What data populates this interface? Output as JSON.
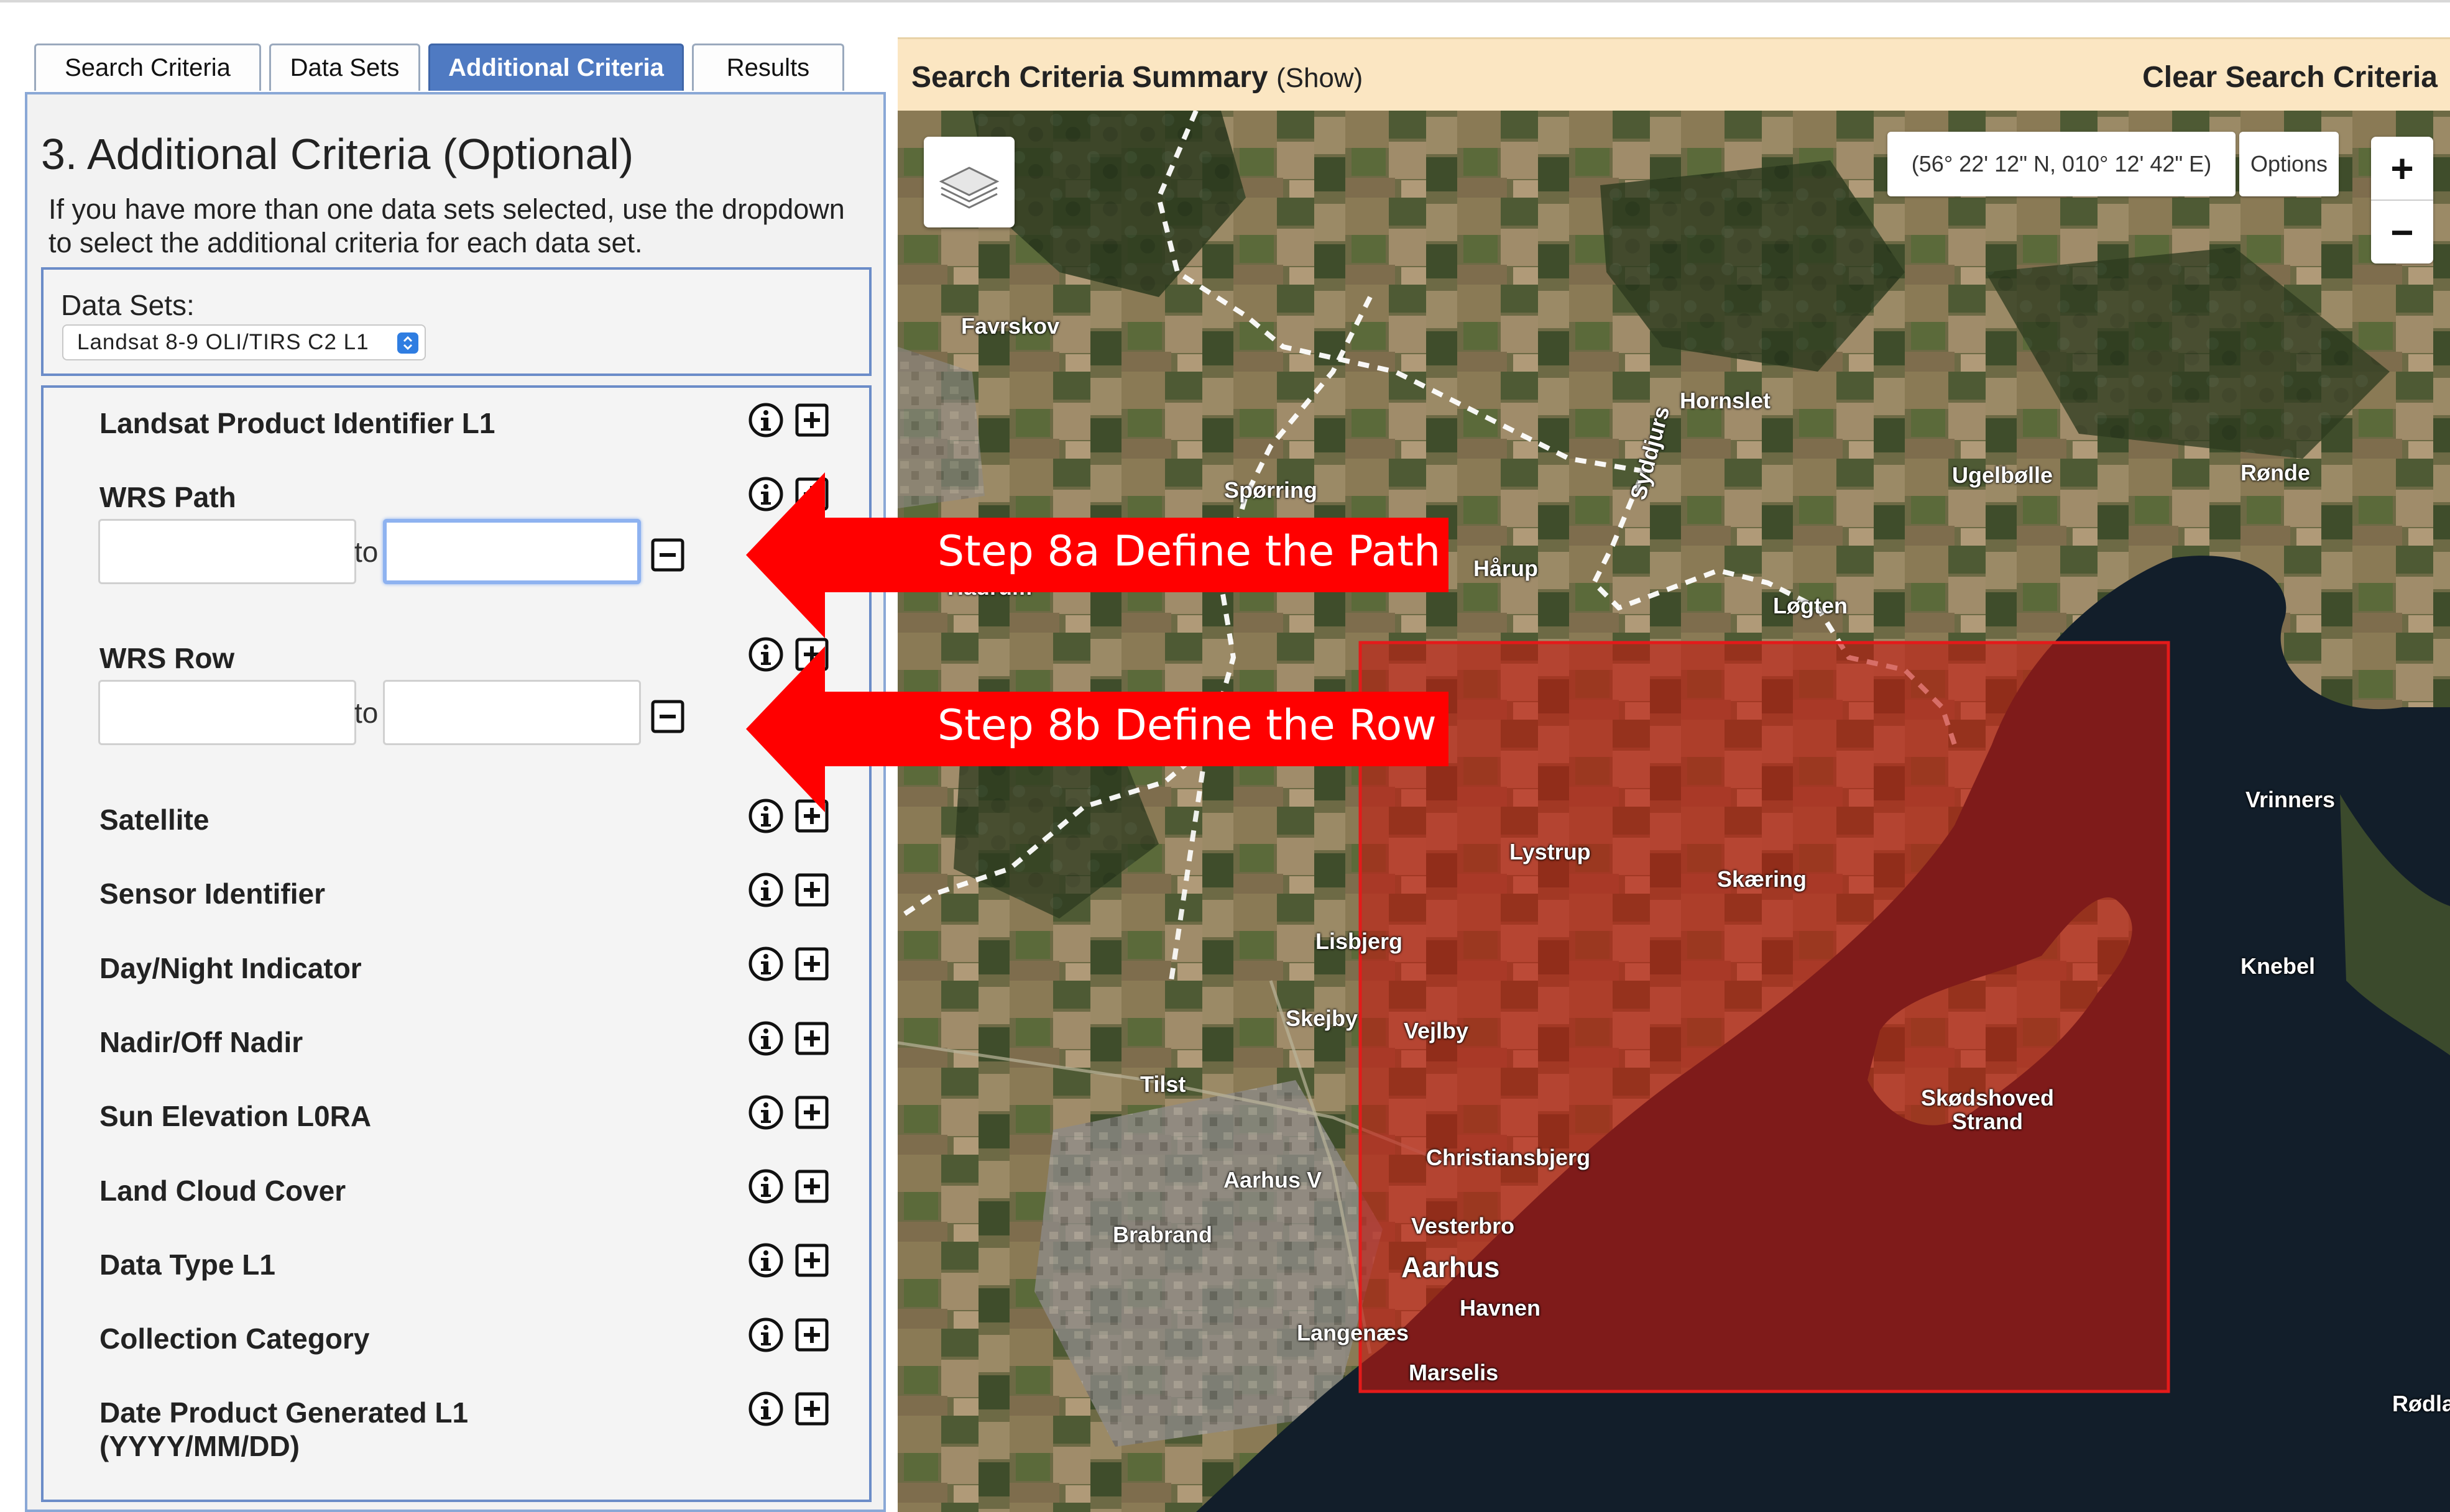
{
  "tabs": [
    {
      "label": "Search Criteria",
      "active": false
    },
    {
      "label": "Data Sets",
      "active": false
    },
    {
      "label": "Additional Criteria",
      "active": true
    },
    {
      "label": "Results",
      "active": false
    }
  ],
  "panel": {
    "title": "3. Additional Criteria (Optional)",
    "description": "If you have more than one data sets selected, use the dropdown to select the additional criteria for each data set.",
    "datasets_label": "Data Sets:",
    "dataset_selected": "Landsat 8-9 OLI/TIRS C2 L1"
  },
  "criteria": [
    {
      "label": "Landsat Product Identifier L1",
      "icons": [
        "info-icon",
        "expand-icon"
      ]
    },
    {
      "label": "WRS Path",
      "range_to": "to",
      "from_value": "",
      "to_value": ""
    },
    {
      "label": "WRS Row",
      "range_to": "to",
      "from_value": "",
      "to_value": ""
    },
    {
      "label": "Satellite"
    },
    {
      "label": "Sensor Identifier"
    },
    {
      "label": "Day/Night Indicator"
    },
    {
      "label": "Nadir/Off Nadir"
    },
    {
      "label": "Sun Elevation L0RA"
    },
    {
      "label": "Land Cloud Cover"
    },
    {
      "label": "Data Type L1"
    },
    {
      "label": "Collection Category"
    },
    {
      "label": "Date Product Generated L1",
      "label2": "(YYYY/MM/DD)"
    }
  ],
  "summary": {
    "title": "Search Criteria Summary",
    "show": "(Show)",
    "clear": "Clear Search Criteria"
  },
  "map": {
    "coordinates": "(56° 22' 12\" N, 010° 12' 42\" E)",
    "options": "Options",
    "zoom_in": "+",
    "zoom_out": "−",
    "places": [
      "Favrskov",
      "Hornslet",
      "Spørring",
      "Syddjurs",
      "Ugelbølle",
      "Rønde",
      "Hårup",
      "Løgten",
      "Hadrum",
      "Lystrup",
      "Skæring",
      "Vrinners",
      "Lisbjerg",
      "Knebel",
      "Skejby",
      "Vejlby",
      "Tilst",
      "Skødshoved",
      "Strand",
      "Christiansbjerg",
      "Aarhus V",
      "Vesterbro",
      "Brabrand",
      "Aarhus",
      "Havnen",
      "Langenæs",
      "Marselis",
      "Rødla"
    ]
  },
  "annotations": {
    "step_a": "Step 8a Define the Path",
    "step_b": "Step 8b Define the Row"
  },
  "colors": {
    "tab_active": "#4f7ac2",
    "summary_bg": "#fbe6c2",
    "annotation_red": "#ff0000",
    "aoi_fill": "#b01010"
  }
}
